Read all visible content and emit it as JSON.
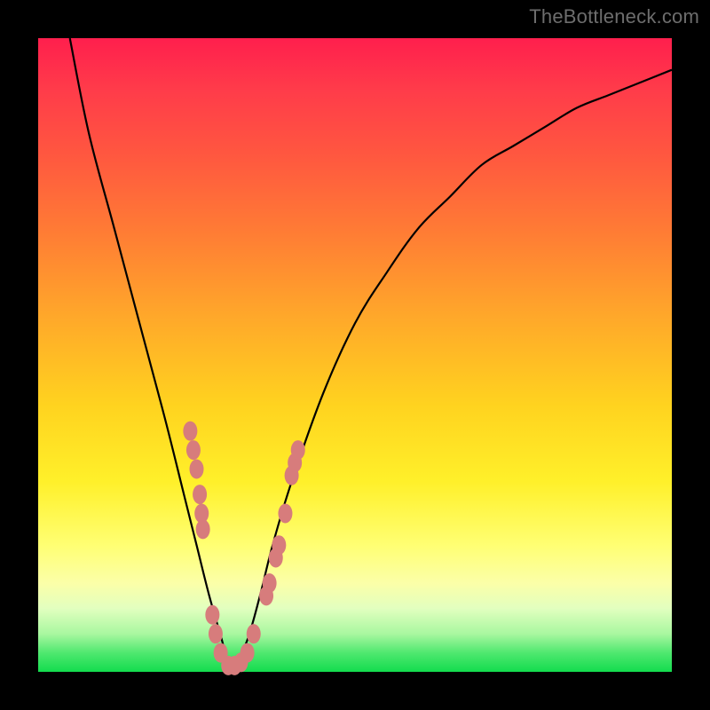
{
  "watermark": "TheBottleneck.com",
  "colors": {
    "frame": "#000000",
    "gradient_top": "#ff1f4d",
    "gradient_bottom": "#13dc4e",
    "curve": "#000000",
    "marker": "#d77c7c"
  },
  "chart_data": {
    "type": "line",
    "title": "",
    "xlabel": "",
    "ylabel": "",
    "xlim": [
      0,
      100
    ],
    "ylim": [
      0,
      100
    ],
    "grid": false,
    "series": [
      {
        "name": "curve",
        "x": [
          5,
          8,
          12,
          16,
          20,
          23,
          25,
          27,
          29,
          30,
          31,
          33,
          35,
          37,
          40,
          45,
          50,
          55,
          60,
          65,
          70,
          75,
          80,
          85,
          90,
          95,
          100
        ],
        "y": [
          100,
          85,
          70,
          55,
          40,
          28,
          20,
          12,
          5,
          1,
          1,
          5,
          12,
          20,
          30,
          44,
          55,
          63,
          70,
          75,
          80,
          83,
          86,
          89,
          91,
          93,
          95
        ]
      }
    ],
    "markers": [
      {
        "x": 24.0,
        "y": 38.0
      },
      {
        "x": 24.5,
        "y": 35.0
      },
      {
        "x": 25.0,
        "y": 32.0
      },
      {
        "x": 25.5,
        "y": 28.0
      },
      {
        "x": 25.8,
        "y": 25.0
      },
      {
        "x": 26.0,
        "y": 22.5
      },
      {
        "x": 27.5,
        "y": 9.0
      },
      {
        "x": 28.0,
        "y": 6.0
      },
      {
        "x": 28.8,
        "y": 3.0
      },
      {
        "x": 30.0,
        "y": 1.0
      },
      {
        "x": 31.0,
        "y": 1.0
      },
      {
        "x": 32.0,
        "y": 1.5
      },
      {
        "x": 33.0,
        "y": 3.0
      },
      {
        "x": 34.0,
        "y": 6.0
      },
      {
        "x": 36.0,
        "y": 12.0
      },
      {
        "x": 36.5,
        "y": 14.0
      },
      {
        "x": 37.5,
        "y": 18.0
      },
      {
        "x": 38.0,
        "y": 20.0
      },
      {
        "x": 39.0,
        "y": 25.0
      },
      {
        "x": 40.0,
        "y": 31.0
      },
      {
        "x": 40.5,
        "y": 33.0
      },
      {
        "x": 41.0,
        "y": 35.0
      }
    ]
  }
}
